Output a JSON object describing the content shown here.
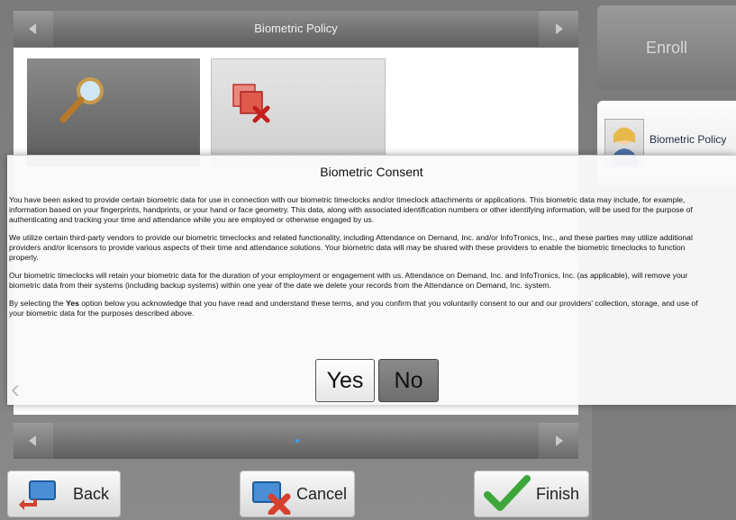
{
  "header": {
    "title": "Biometric Policy"
  },
  "sidebar": {
    "enroll_label": "Enroll",
    "policy_label": "Biometric Policy"
  },
  "dialog": {
    "title": "Biometric Consent",
    "paragraphs": [
      [
        "You have been asked to provide certain biometric data for use in connection with our biometric timeclocks and/or timeclock attachments or applications. This biometric data may include, for example,",
        "information based on your fingerprints, handprints, or your hand or face geometry. This data, along with associated identification numbers or other identifying information, will be used for the purpose of",
        "authenticating and tracking your time and attendance while you are employed or otherwise engaged by us."
      ],
      [
        "We utilize certain third-party vendors to provide our biometric timeclocks and related functionality, including Attendance on Demand, Inc. and/or InfoTronics, Inc., and these parties may utilize additional",
        "providers and/or licensors to provide various aspects of their time and attendance solutions. Your biometric data will may be shared with these providers to enable the biometric timeclocks to function",
        "properly."
      ],
      [
        "Our biometric timeclocks will retain your biometric data for the duration of your employment or engagement with us. Attendance on Demand, Inc. and InfoTronics, Inc. (as applicable), will remove your",
        "biometric data from their systems (including backup systems) within one year of the date we delete your records from the Attendance on Demand, Inc. system."
      ],
      [
        "By selecting the Yes option below you acknowledge that you have read and understand these terms, and you confirm that you voluntarily consent to our and our providers' collection, storage, and use of",
        "your biometric data for the purposes described above."
      ]
    ],
    "yes_label": "Yes",
    "no_label": "No"
  },
  "footer": {
    "back_label": "Back",
    "cancel_label": "Cancel",
    "finish_label": "Finish"
  },
  "colors": {
    "accent_green": "#3da63a",
    "accent_red": "#d63b2b",
    "accent_blue": "#2f7fd0"
  },
  "icons": [
    "magnifier-icon",
    "delete-icon",
    "user-avatar-icon",
    "back-arrow-icon",
    "cancel-icon",
    "checkmark-icon",
    "chevron-left-icon"
  ]
}
